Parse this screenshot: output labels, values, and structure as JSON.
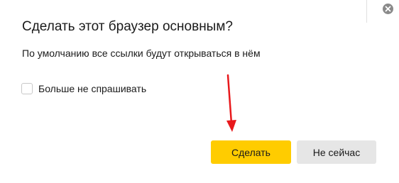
{
  "dialog": {
    "title": "Сделать этот браузер основным?",
    "message": "По умолчанию все ссылки будут открываться в нём",
    "checkbox": {
      "label": "Больше не спрашивать",
      "checked": false
    },
    "buttons": {
      "primary_label": "Сделать",
      "secondary_label": "Не сейчас"
    },
    "close_icon": "close-icon"
  },
  "colors": {
    "primary_button": "#ffcc00",
    "secondary_button": "#e6e6e6",
    "annotation_arrow": "#e8191c",
    "close_icon_bg": "#8a8a8a"
  },
  "annotation": {
    "arrow_icon": "arrow-down-icon"
  }
}
